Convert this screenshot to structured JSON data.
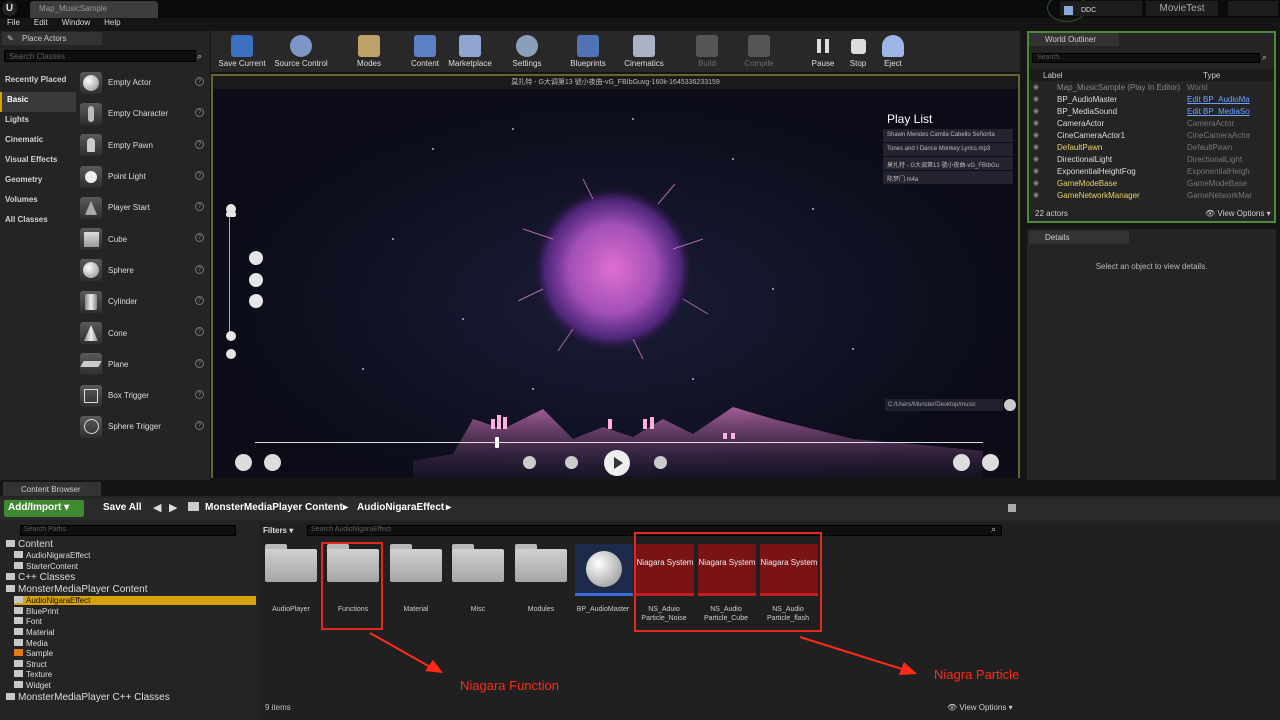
{
  "titlebar": {
    "doc_tab": "Map_MusicSample",
    "ddc": "DDC",
    "project": "MovieTest"
  },
  "menu": [
    "File",
    "Edit",
    "Window",
    "Help"
  ],
  "place_actors": {
    "tab": "Place Actors",
    "search_placeholder": "Search Classes",
    "categories": [
      "Recently Placed",
      "Basic",
      "Lights",
      "Cinematic",
      "Visual Effects",
      "Geometry",
      "Volumes",
      "All Classes"
    ],
    "actors": [
      "Empty Actor",
      "Empty Character",
      "Empty Pawn",
      "Point Light",
      "Player Start",
      "Cube",
      "Sphere",
      "Cylinder",
      "Cone",
      "Plane",
      "Box Trigger",
      "Sphere Trigger"
    ]
  },
  "toolbar": {
    "save_current": "Save Current",
    "source_control": "Source Control",
    "modes": "Modes",
    "content": "Content",
    "marketplace": "Marketplace",
    "settings": "Settings",
    "blueprints": "Blueprints",
    "cinematics": "Cinematics",
    "build": "Build",
    "compile": "Compile",
    "pause": "Pause",
    "stop": "Stop",
    "eject": "Eject"
  },
  "viewport": {
    "title": "莫扎特 - G大调第13 號小夜曲-vG_FBIbGuvg-160k-1645336233159",
    "playlist_title": "Play List",
    "playlist": [
      "Shawn Mendes Camila Cabello  Señorita",
      "Tones and I  Dance Monkey Lyrics.mp3",
      "莫扎特 - G大调第13 號小夜曲-vG_FBIbGu",
      "陈梦门.m4a"
    ],
    "music_path": "C:/Users/Monster/Desktop/music"
  },
  "outliner": {
    "tab": "World Outliner",
    "search_placeholder": "Search...",
    "col_label": "Label",
    "col_type": "Type",
    "rows": [
      {
        "name": "Map_MusicSample (Play In Editor)",
        "type": "World"
      },
      {
        "name": "BP_AudioMaster",
        "type": "Edit BP_AudioMa"
      },
      {
        "name": "BP_MediaSound",
        "type": "Edit BP_MediaSo"
      },
      {
        "name": "CameraActor",
        "type": "CameraActor"
      },
      {
        "name": "CineCameraActor1",
        "type": "CineCameraActor"
      },
      {
        "name": "DefaultPawn",
        "type": "DefaultPawn"
      },
      {
        "name": "DirectionalLight",
        "type": "DirectionalLight"
      },
      {
        "name": "ExponentialHeightFog",
        "type": "ExponentialHeigh"
      },
      {
        "name": "GameModeBase",
        "type": "GameModeBase"
      },
      {
        "name": "GameNetworkManager",
        "type": "GameNetworkMar"
      }
    ],
    "count": "22 actors",
    "view_options": "View Options"
  },
  "details": {
    "tab": "Details",
    "empty": "Select an object to view details."
  },
  "content_browser": {
    "tab": "Content Browser",
    "add_import": "Add/Import",
    "save_all": "Save All",
    "crumb1": "MonsterMediaPlayer Content",
    "crumb2": "AudioNigaraEffect",
    "search_paths": "Search Paths",
    "filters": "Filters",
    "search_assets": "Search AudioNigaraEffect",
    "tree": [
      {
        "label": "Content",
        "level": 0,
        "big": true
      },
      {
        "label": "AudioNigaraEffect",
        "level": 1
      },
      {
        "label": "StarterContent",
        "level": 1
      },
      {
        "label": "C++ Classes",
        "level": 0,
        "big": true
      },
      {
        "label": "MonsterMediaPlayer Content",
        "level": 0,
        "big": true
      },
      {
        "label": "AudioNigaraEffect",
        "level": 1,
        "selected": true
      },
      {
        "label": "BluePrint",
        "level": 1
      },
      {
        "label": "Font",
        "level": 1
      },
      {
        "label": "Material",
        "level": 1
      },
      {
        "label": "Media",
        "level": 1
      },
      {
        "label": "Sample",
        "level": 1
      },
      {
        "label": "Struct",
        "level": 1
      },
      {
        "label": "Texture",
        "level": 1
      },
      {
        "label": "Widget",
        "level": 1
      },
      {
        "label": "MonsterMediaPlayer C++ Classes",
        "level": 0,
        "big": true
      }
    ],
    "assets": [
      {
        "name": "AudioPlayer",
        "kind": "folder"
      },
      {
        "name": "Functions",
        "kind": "folder"
      },
      {
        "name": "Material",
        "kind": "folder"
      },
      {
        "name": "Misc",
        "kind": "folder"
      },
      {
        "name": "Modules",
        "kind": "folder"
      },
      {
        "name": "BP_AudioMaster",
        "kind": "sphere"
      },
      {
        "name": "NS_Aduio Particle_Noise",
        "kind": "niagara"
      },
      {
        "name": "NS_Audio Particle_Cube",
        "kind": "niagara"
      },
      {
        "name": "NS_Audio Particle_flash",
        "kind": "niagara"
      }
    ],
    "niagara_label": "Niagara System",
    "item_count": "9 items",
    "view_options": "View Options"
  },
  "annotations": {
    "function": "Niagara Function",
    "particle": "Niagra Particle",
    "color": "#ff2a1a"
  }
}
